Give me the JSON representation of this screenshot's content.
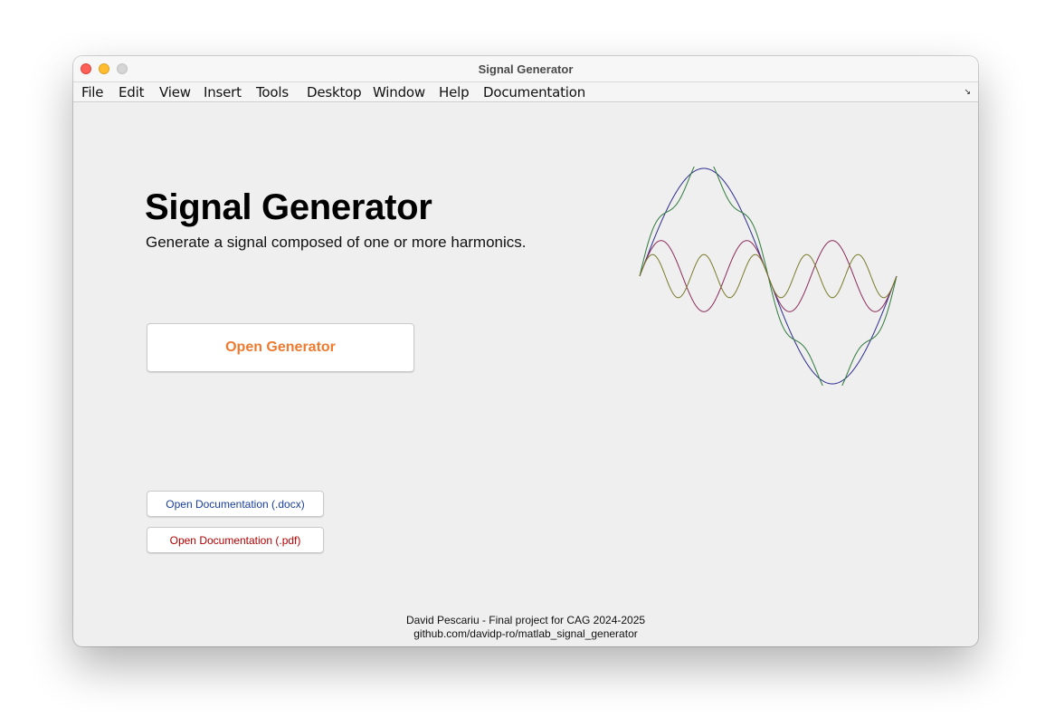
{
  "window": {
    "title": "Signal Generator"
  },
  "menubar": {
    "items": [
      "File",
      "Edit",
      "View",
      "Insert",
      "Tools",
      "Desktop",
      "Window",
      "Help",
      "Documentation"
    ],
    "corner_glyph": "↘"
  },
  "main": {
    "title": "Signal Generator",
    "subtitle": "Generate a signal composed of one or more harmonics.",
    "open_generator_label": "Open Generator",
    "open_docx_label": "Open Documentation (.docx)",
    "open_pdf_label": "Open Documentation (.pdf)"
  },
  "footer": {
    "credit": "David Pescariu - Final project for CAG 2024-2025",
    "repo": "github.com/davidp-ro/matlab_signal_generator"
  },
  "colors": {
    "primary_button_text": "#ee7a30",
    "docx_button_text": "#1a3f9a",
    "pdf_button_text": "#b00000",
    "wave_fundamental": "#2d2d8f",
    "wave_sum": "#2f7a3a",
    "wave_harmonic_a": "#8a2a5a",
    "wave_harmonic_b": "#7a7a2a"
  },
  "illustration": {
    "curves": [
      {
        "name": "fundamental",
        "harmonics": [
          1
        ],
        "amplitudes": [
          1.0
        ],
        "color": "#2d2d8f"
      },
      {
        "name": "sum",
        "harmonics": [
          1,
          5
        ],
        "amplitudes": [
          1.0,
          0.12
        ],
        "color": "#2f7a3a"
      },
      {
        "name": "harmonic-a",
        "harmonics": [
          3
        ],
        "amplitudes": [
          0.33
        ],
        "color": "#8a2a5a"
      },
      {
        "name": "harmonic-b",
        "harmonics": [
          5
        ],
        "amplitudes": [
          0.2
        ],
        "color": "#7a7a2a"
      }
    ]
  }
}
